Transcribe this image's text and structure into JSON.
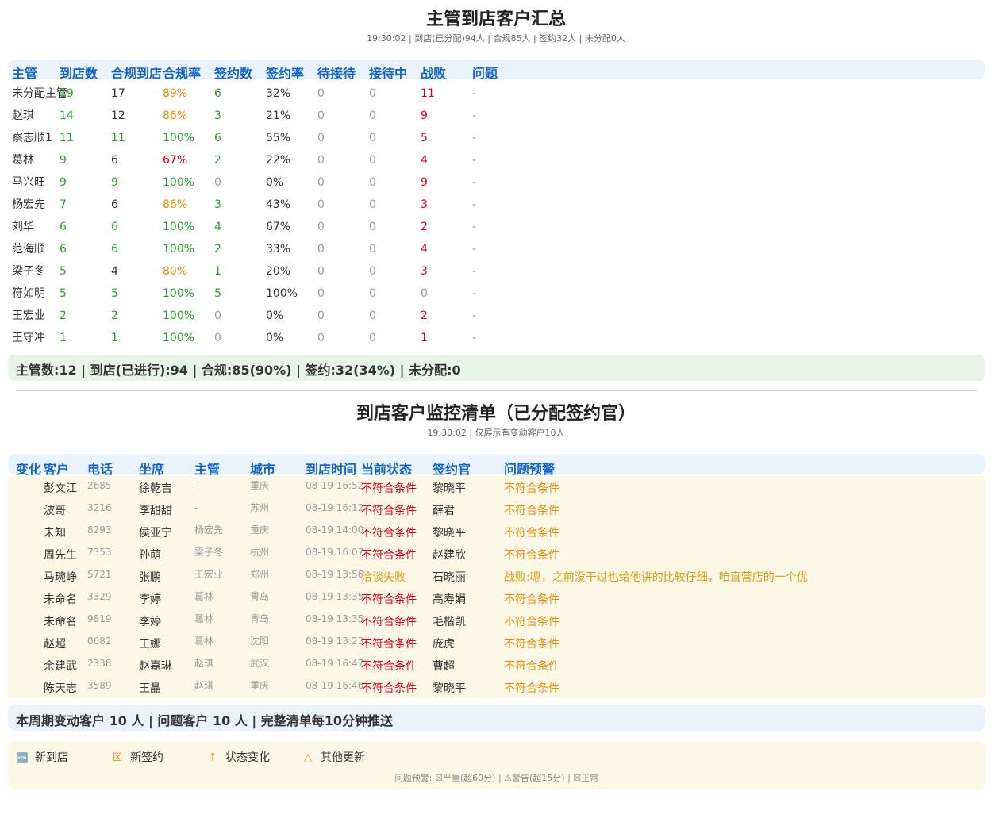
{
  "summary_section": {
    "title": "主管到店客户汇总",
    "subtitle": "19:30:02 | 到店(已分配)94人 | 合规85人 | 签约32人 | 未分配0人",
    "headers": [
      "主管",
      "到店数",
      "合规到店",
      "合规率",
      "签约数",
      "签约率",
      "待接待",
      "接待中",
      "战败",
      "问题"
    ],
    "rows": [
      {
        "name": "未分配主管",
        "arrive": "19",
        "compliant": "17",
        "rate": "89%",
        "signed": "6",
        "sign_rate": "32%",
        "waiting": "0",
        "serving": "0",
        "lost": "11",
        "issue": "-"
      },
      {
        "name": "赵琪",
        "arrive": "14",
        "compliant": "12",
        "rate": "86%",
        "signed": "3",
        "sign_rate": "21%",
        "waiting": "0",
        "serving": "0",
        "lost": "9",
        "issue": "-"
      },
      {
        "name": "察志顺1",
        "arrive": "11",
        "compliant": "11",
        "rate": "100%",
        "signed": "6",
        "sign_rate": "55%",
        "waiting": "0",
        "serving": "0",
        "lost": "5",
        "issue": "-"
      },
      {
        "name": "葛林",
        "arrive": "9",
        "compliant": "6",
        "rate": "67%",
        "signed": "2",
        "sign_rate": "22%",
        "waiting": "0",
        "serving": "0",
        "lost": "4",
        "issue": "-"
      },
      {
        "name": "马兴旺",
        "arrive": "9",
        "compliant": "9",
        "rate": "100%",
        "signed": "0",
        "sign_rate": "0%",
        "waiting": "0",
        "serving": "0",
        "lost": "9",
        "issue": "-"
      },
      {
        "name": "杨宏先",
        "arrive": "7",
        "compliant": "6",
        "rate": "86%",
        "signed": "3",
        "sign_rate": "43%",
        "waiting": "0",
        "serving": "0",
        "lost": "3",
        "issue": "-"
      },
      {
        "name": "刘华",
        "arrive": "6",
        "compliant": "6",
        "rate": "100%",
        "signed": "4",
        "sign_rate": "67%",
        "waiting": "0",
        "serving": "0",
        "lost": "2",
        "issue": "-"
      },
      {
        "name": "范海顺",
        "arrive": "6",
        "compliant": "6",
        "rate": "100%",
        "signed": "2",
        "sign_rate": "33%",
        "waiting": "0",
        "serving": "0",
        "lost": "4",
        "issue": "-"
      },
      {
        "name": "梁子冬",
        "arrive": "5",
        "compliant": "4",
        "rate": "80%",
        "signed": "1",
        "sign_rate": "20%",
        "waiting": "0",
        "serving": "0",
        "lost": "3",
        "issue": "-"
      },
      {
        "name": "符如明",
        "arrive": "5",
        "compliant": "5",
        "rate": "100%",
        "signed": "5",
        "sign_rate": "100%",
        "waiting": "0",
        "serving": "0",
        "lost": "0",
        "issue": "-"
      },
      {
        "name": "王宏业",
        "arrive": "2",
        "compliant": "2",
        "rate": "100%",
        "signed": "0",
        "sign_rate": "0%",
        "waiting": "0",
        "serving": "0",
        "lost": "2",
        "issue": "-"
      },
      {
        "name": "王守冲",
        "arrive": "1",
        "compliant": "1",
        "rate": "100%",
        "signed": "0",
        "sign_rate": "0%",
        "waiting": "0",
        "serving": "0",
        "lost": "1",
        "issue": "-"
      }
    ],
    "totals": "主管数:12 | 到店(已进行):94 | 合规:85(90%) | 签约:32(34%) | 未分配:0"
  },
  "monitor_section": {
    "title": "到店客户监控清单（已分配签约官）",
    "subtitle": "19:30:02 | 仅展示有变动客户10人",
    "headers": [
      "变化",
      "客户",
      "电话",
      "坐席",
      "主管",
      "城市",
      "到店时间",
      "当前状态",
      "签约官",
      "问题预警"
    ],
    "rows": [
      {
        "customer": "彭文江",
        "phone": "2685",
        "agent": "徐乾吉",
        "manager": "-",
        "city": "重庆",
        "time": "08-19 16:52",
        "status": "不符合条件",
        "officer": "黎晓平",
        "warning": "不符合条件"
      },
      {
        "customer": "波哥",
        "phone": "3216",
        "agent": "李甜甜",
        "manager": "-",
        "city": "苏州",
        "time": "08-19 16:12",
        "status": "不符合条件",
        "officer": "薛君",
        "warning": "不符合条件"
      },
      {
        "customer": "未知",
        "phone": "8293",
        "agent": "侯亚宁",
        "manager": "杨宏先",
        "city": "重庆",
        "time": "08-19 14:00",
        "status": "不符合条件",
        "officer": "黎晓平",
        "warning": "不符合条件"
      },
      {
        "customer": "周先生",
        "phone": "7353",
        "agent": "孙萌",
        "manager": "梁子冬",
        "city": "杭州",
        "time": "08-19 16:07",
        "status": "不符合条件",
        "officer": "赵建欣",
        "warning": "不符合条件"
      },
      {
        "customer": "马琬峥",
        "phone": "5721",
        "agent": "张鹏",
        "manager": "王宏业",
        "city": "郑州",
        "time": "08-19 13:56",
        "status": "洽谈失败",
        "officer": "石晓丽",
        "warning": "战败:嗯，之前没干过也给他讲的比较仔细，咱直营店的一个优"
      },
      {
        "customer": "未命名",
        "phone": "3329",
        "agent": "李婷",
        "manager": "葛林",
        "city": "青岛",
        "time": "08-19 13:35",
        "status": "不符合条件",
        "officer": "高寿娟",
        "warning": "不符合条件"
      },
      {
        "customer": "未命名",
        "phone": "9819",
        "agent": "李婷",
        "manager": "葛林",
        "city": "青岛",
        "time": "08-19 13:35",
        "status": "不符合条件",
        "officer": "毛楷凯",
        "warning": "不符合条件"
      },
      {
        "customer": "赵超",
        "phone": "0682",
        "agent": "王娜",
        "manager": "葛林",
        "city": "沈阳",
        "time": "08-19 13:23",
        "status": "不符合条件",
        "officer": "庞虎",
        "warning": "不符合条件"
      },
      {
        "customer": "余建武",
        "phone": "2338",
        "agent": "赵嘉琳",
        "manager": "赵琪",
        "city": "武汉",
        "time": "08-19 16:47",
        "status": "不符合条件",
        "officer": "曹超",
        "warning": "不符合条件"
      },
      {
        "customer": "陈天志",
        "phone": "3589",
        "agent": "王晶",
        "manager": "赵琪",
        "city": "重庆",
        "time": "08-19 16:46",
        "status": "不符合条件",
        "officer": "黎晓平",
        "warning": "不符合条件"
      }
    ],
    "footer": "本周期变动客户 10 人 | 问题客户 10 人 | 完整清单每10分钟推送"
  },
  "legend": {
    "items": [
      {
        "icon": "new-icon",
        "glyph": "🆕",
        "label": "新到店"
      },
      {
        "icon": "sign-icon",
        "glyph": "☒",
        "label": "新签约"
      },
      {
        "icon": "arrow-up-icon",
        "glyph": "↑",
        "label": "状态变化"
      },
      {
        "icon": "triangle-icon",
        "glyph": "△",
        "label": "其他更新"
      }
    ],
    "note": "问题预警: ☒严重(超60分) | ⚠警告(超15分) | ☒正常"
  },
  "colors": {
    "header_blue": "#1565c0",
    "green": "#2a9d2a",
    "red": "#d0021b",
    "orange": "#e08e0b",
    "gold": "#d4a017"
  }
}
